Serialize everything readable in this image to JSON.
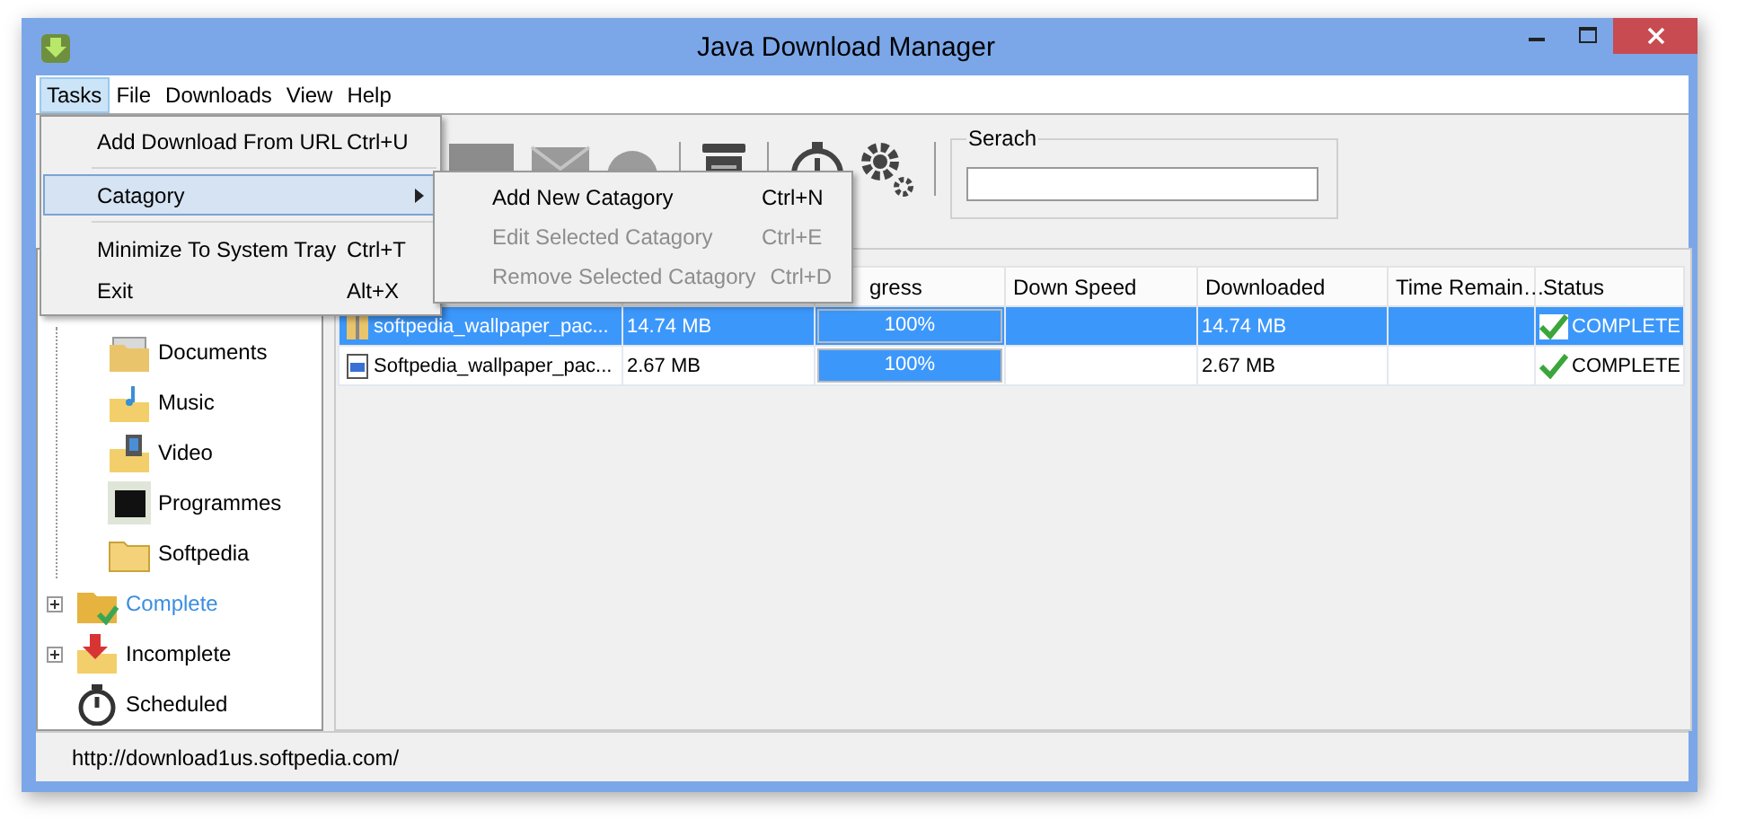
{
  "window": {
    "title": "Java Download Manager"
  },
  "menu_bar": [
    {
      "label": "Tasks",
      "selected": true
    },
    {
      "label": "File",
      "selected": false
    },
    {
      "label": "Downloads",
      "selected": false
    },
    {
      "label": "View",
      "selected": false
    },
    {
      "label": "Help",
      "selected": false
    }
  ],
  "tasks_menu": [
    {
      "kind": "item",
      "label": "Add Download From URL",
      "shortcut": "Ctrl+U",
      "selected": false
    },
    {
      "kind": "separator"
    },
    {
      "kind": "submenu",
      "label": "Catagory",
      "selected": true
    },
    {
      "kind": "separator"
    },
    {
      "kind": "item",
      "label": "Minimize To System Tray",
      "shortcut": "Ctrl+T",
      "selected": false
    },
    {
      "kind": "item",
      "label": "Exit",
      "shortcut": "Alt+X",
      "selected": false
    }
  ],
  "category_submenu": [
    {
      "label": "Add New Catagory",
      "shortcut": "Ctrl+N",
      "disabled": false
    },
    {
      "label": "Edit Selected Catagory",
      "shortcut": "Ctrl+E",
      "disabled": true
    },
    {
      "label": "Remove Selected Catagory",
      "shortcut": "Ctrl+D",
      "disabled": true
    }
  ],
  "search": {
    "label": "Serach"
  },
  "sidebar": {
    "items": [
      {
        "children": [
          {
            "kind": "documents",
            "label": "Documents",
            "selected": false
          },
          {
            "kind": "music",
            "label": "Music",
            "selected": false
          },
          {
            "kind": "video",
            "label": "Video",
            "selected": false
          },
          {
            "kind": "programmes",
            "label": "Programmes",
            "selected": false
          },
          {
            "kind": "folder",
            "label": "Softpedia",
            "selected": false
          }
        ]
      },
      {
        "kind": "complete",
        "label": "Complete",
        "expanded": false,
        "selected": true
      },
      {
        "kind": "incomplete",
        "label": "Incomplete",
        "expanded": false,
        "selected": false
      },
      {
        "kind": "scheduled",
        "label": "Scheduled",
        "selected": false
      }
    ]
  },
  "table": {
    "columns": [
      null,
      null,
      "gress",
      "Down Speed",
      "Downloaded",
      "Time Remain…",
      "Status"
    ],
    "rows": [
      {
        "selected": true,
        "kind": "archive",
        "name": "softpedia_wallpaper_pac...",
        "size": "14.74 MB",
        "level": 1,
        "progress": "100%",
        "downloaded": "14.74 MB",
        "status": "COMPLETE"
      },
      {
        "selected": false,
        "kind": "image",
        "name": "Softpedia_wallpaper_pac...",
        "size": "2.67 MB",
        "level": 1,
        "progress": "100%",
        "downloaded": "2.67 MB",
        "status": "COMPLETE"
      }
    ]
  },
  "status_bar": "http://download1us.softpedia.com/"
}
